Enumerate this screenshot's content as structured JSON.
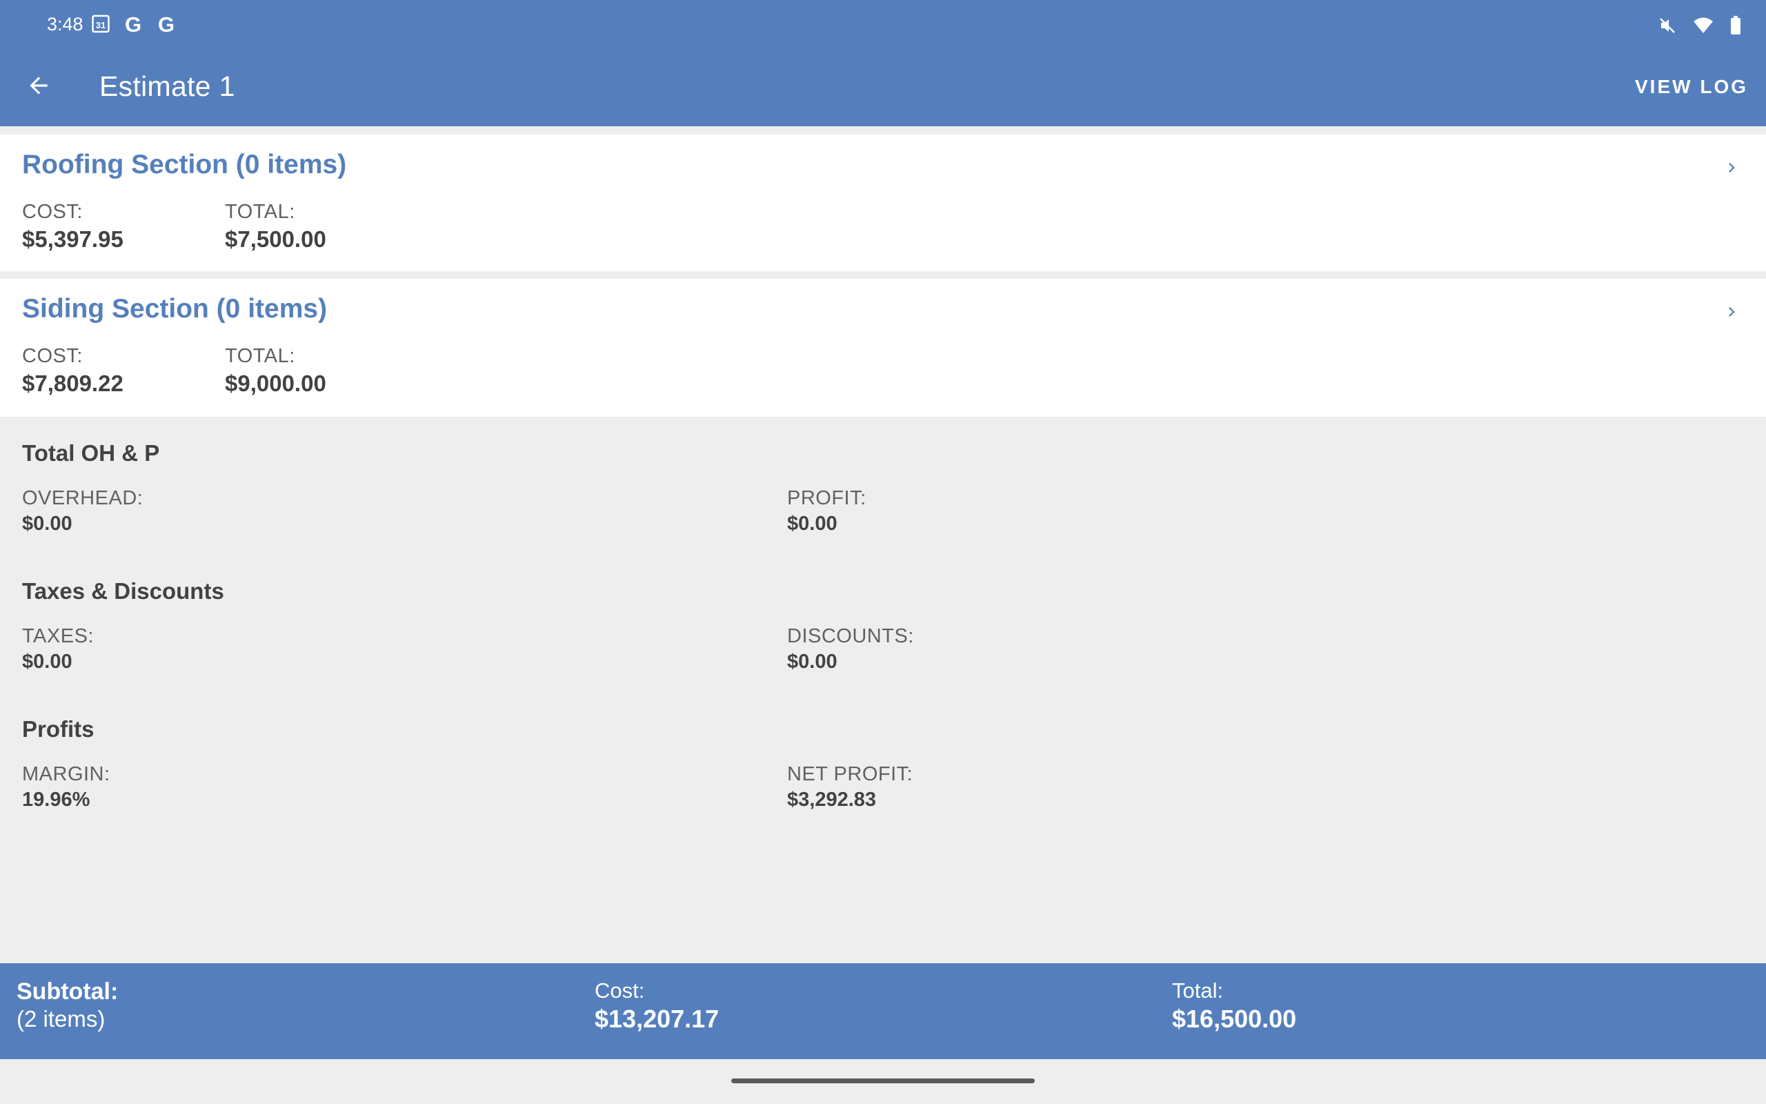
{
  "status_bar": {
    "time": "3:48",
    "calendar_day": "31",
    "g1": "G",
    "g2": "G",
    "icons": [
      "mute-icon",
      "wifi-icon",
      "battery-icon"
    ]
  },
  "header": {
    "title": "Estimate 1",
    "view_log": "VIEW LOG"
  },
  "sections": [
    {
      "title": "Roofing Section (0 items)",
      "cost_label": "COST:",
      "cost": "$5,397.95",
      "total_label": "TOTAL:",
      "total": "$7,500.00"
    },
    {
      "title": "Siding Section (0 items)",
      "cost_label": "COST:",
      "cost": "$7,809.22",
      "total_label": "TOTAL:",
      "total": "$9,000.00"
    }
  ],
  "summary": {
    "ohp": {
      "title": "Total OH & P",
      "left_label": "OVERHEAD:",
      "left_value": "$0.00",
      "right_label": "PROFIT:",
      "right_value": "$0.00"
    },
    "taxes": {
      "title": "Taxes & Discounts",
      "left_label": "TAXES:",
      "left_value": "$0.00",
      "right_label": "DISCOUNTS:",
      "right_value": "$0.00"
    },
    "profits": {
      "title": "Profits",
      "left_label": "MARGIN:",
      "left_value": "19.96%",
      "right_label": "NET PROFIT:",
      "right_value": "$3,292.83"
    }
  },
  "footer": {
    "subtotal_label": "Subtotal:",
    "items": "(2 items)",
    "cost_label": "Cost:",
    "cost": "$13,207.17",
    "total_label": "Total:",
    "total": "$16,500.00"
  },
  "colors": {
    "primary": "#557fbc",
    "section_title": "#5580bb",
    "background": "#eeeeee"
  }
}
